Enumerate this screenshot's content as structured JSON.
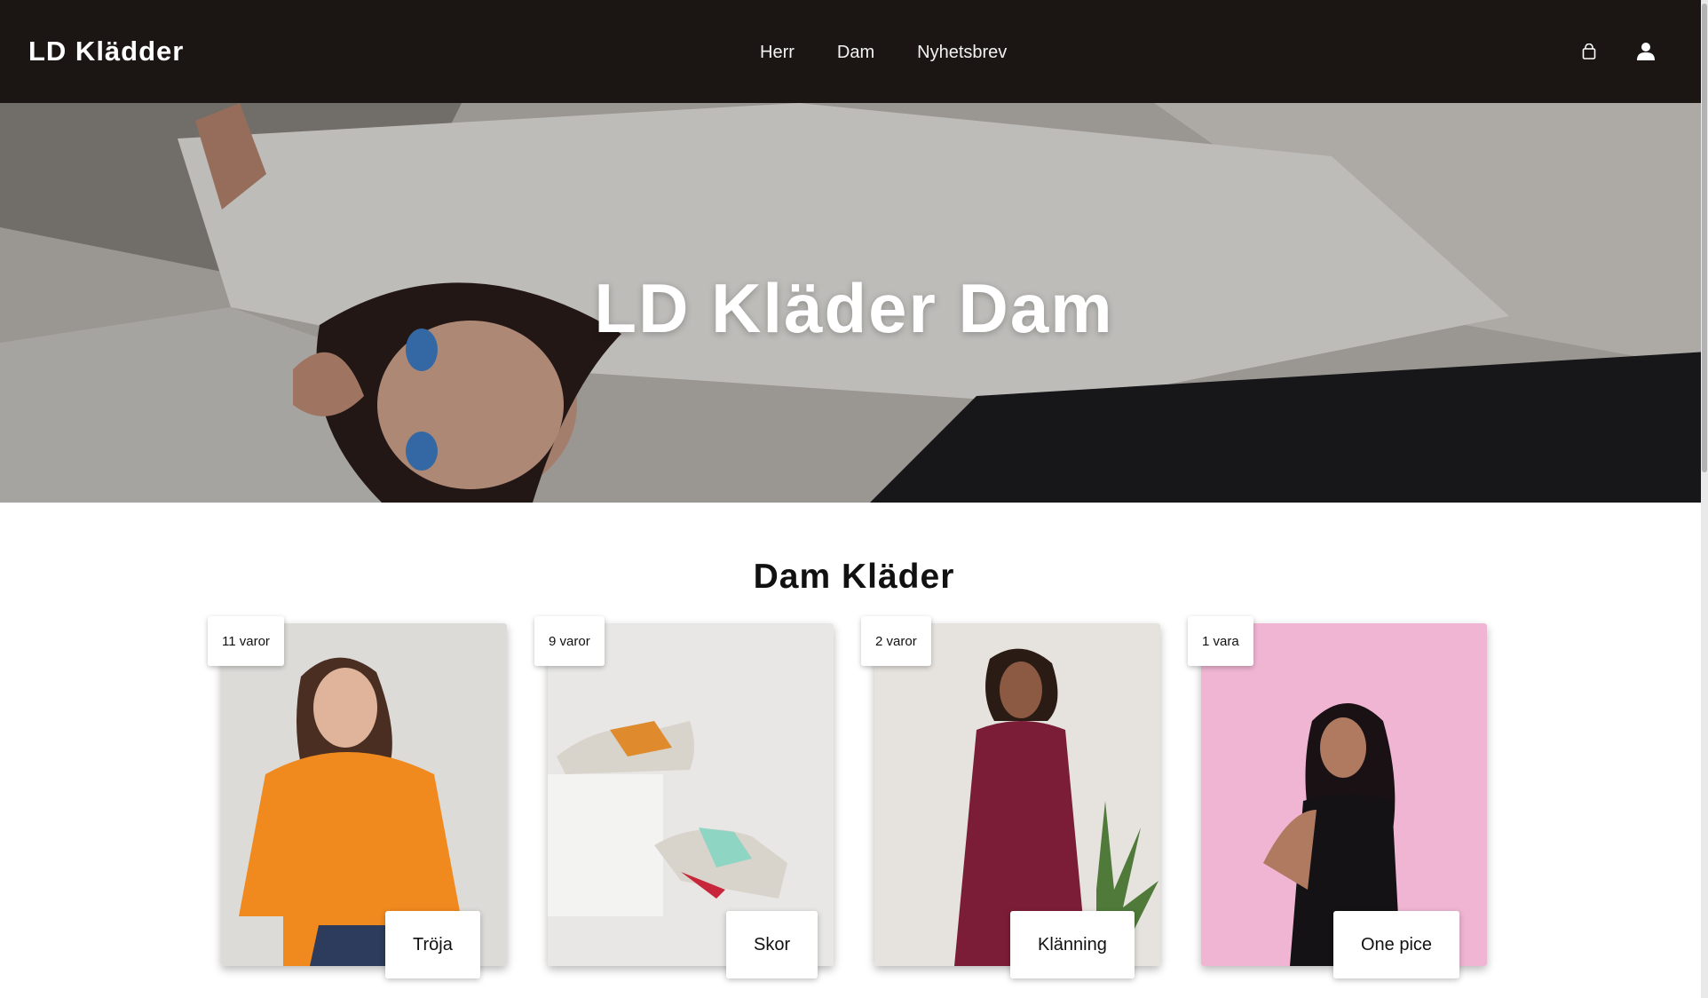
{
  "navbar": {
    "brand": "LD Klädder",
    "links": [
      "Herr",
      "Dam",
      "Nyhetsbrev"
    ],
    "icons": [
      "shopping-bag-icon",
      "user-icon"
    ],
    "background": "#1b1613"
  },
  "hero": {
    "title": "LD Kläder Dam"
  },
  "section": {
    "title": "Dam Kläder"
  },
  "categories": [
    {
      "count": "11 varor",
      "label": "Tröja",
      "bg": "#d9d7d3",
      "accent": "#f08a1e"
    },
    {
      "count": "9 varor",
      "label": "Skor",
      "bg": "#e6e5e3",
      "accent": "#d8a33a"
    },
    {
      "count": "2 varor",
      "label": "Klänning",
      "bg": "#e7e4df",
      "accent": "#7b1d36"
    },
    {
      "count": "1 vara",
      "label": "One pice",
      "bg": "#efb5d3",
      "accent": "#111111"
    }
  ]
}
